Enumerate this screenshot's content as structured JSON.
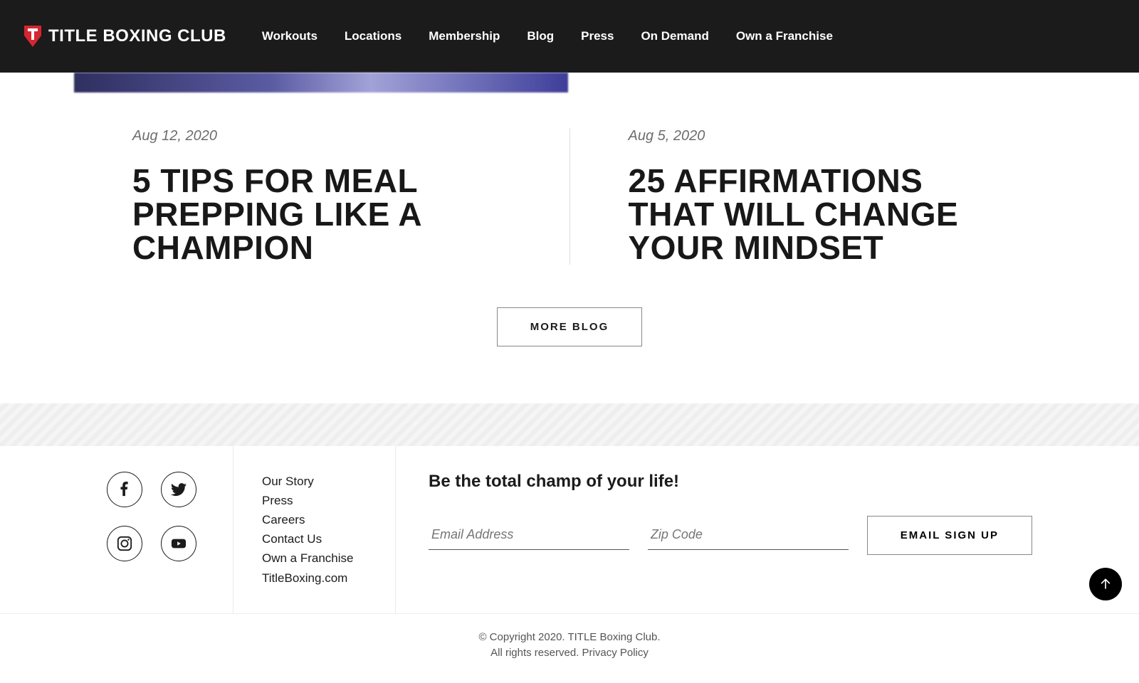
{
  "brand": {
    "name": "TITLE BOXING CLUB"
  },
  "nav": {
    "items": [
      "Workouts",
      "Locations",
      "Membership",
      "Blog",
      "Press",
      "On Demand",
      "Own a Franchise"
    ]
  },
  "blog": {
    "posts": [
      {
        "date": "Aug 12, 2020",
        "title": "5 TIPS FOR MEAL PREPPING LIKE A CHAMPION"
      },
      {
        "date": "Aug 5, 2020",
        "title": "25 AFFIRMATIONS THAT WILL CHANGE YOUR MINDSET"
      }
    ],
    "more_label": "MORE BLOG"
  },
  "footer": {
    "links": [
      "Our Story",
      "Press",
      "Careers",
      "Contact Us",
      "Own a Franchise",
      "TitleBoxing.com"
    ],
    "signup": {
      "heading": "Be the total champ of your life!",
      "email_placeholder": "Email Address",
      "zip_placeholder": "Zip Code",
      "button": "EMAIL SIGN UP"
    },
    "legal": {
      "copyright": "© Copyright 2020. TITLE Boxing Club.",
      "rights": "All rights reserved. ",
      "privacy": "Privacy Policy"
    },
    "social": [
      "facebook",
      "twitter",
      "instagram",
      "youtube"
    ]
  }
}
